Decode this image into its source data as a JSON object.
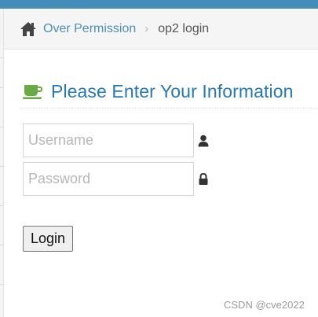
{
  "breadcrumb": {
    "home_icon": "home-icon",
    "parent": "Over Permission",
    "separator": "›",
    "current": "op2 login"
  },
  "header": {
    "icon": "coffee-cup-icon",
    "title": "Please Enter Your Information",
    "title_color": "#2679b5",
    "icon_color": "#69aa46"
  },
  "form": {
    "username_placeholder": "Username",
    "username_value": "",
    "username_icon": "user-icon",
    "password_placeholder": "Password",
    "password_value": "",
    "password_icon": "lock-icon",
    "submit_label": "Login"
  },
  "watermark": "CSDN @cve2022",
  "colors": {
    "accent": "#438eb9",
    "link": "#4c8fbd"
  }
}
